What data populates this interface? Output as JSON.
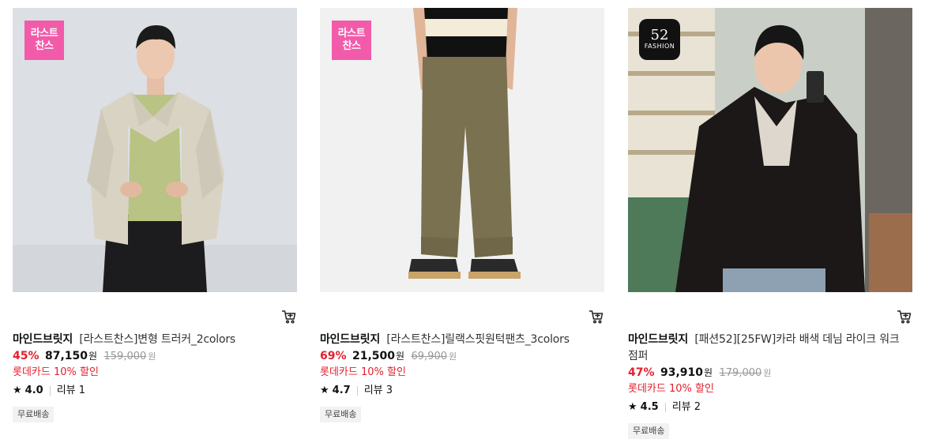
{
  "products": [
    {
      "badge_line1": "라스트",
      "badge_line2": "찬스",
      "brand": "마인드브릿지",
      "name": "[라스트찬스]변형 트러커_2colors",
      "discount_rate": "45%",
      "price": "87,150",
      "currency": "원",
      "original_price": "159,000",
      "card_discount": "롯데카드 10% 할인",
      "rating": "4.0",
      "review_label": "리뷰 1",
      "shipping_tag": "무료배송",
      "image_icon": "model-jacket-image"
    },
    {
      "badge_line1": "라스트",
      "badge_line2": "찬스",
      "brand": "마인드브릿지",
      "name": "[라스트찬스]릴랙스핏원턱팬츠_3colors",
      "discount_rate": "69%",
      "price": "21,500",
      "currency": "원",
      "original_price": "69,900",
      "card_discount": "롯데카드 10% 할인",
      "rating": "4.7",
      "review_label": "리뷰 3",
      "shipping_tag": "무료배송",
      "image_icon": "pants-image"
    },
    {
      "logo_top": "52",
      "logo_text": "FASHION",
      "brand": "마인드브릿지",
      "name": "[패션52][25FW]카라 배색 데님 라이크 워크 점퍼",
      "discount_rate": "47%",
      "price": "93,910",
      "currency": "원",
      "original_price": "179,000",
      "card_discount": "롯데카드 10% 할인",
      "rating": "4.5",
      "review_label": "리뷰 2",
      "shipping_tag": "무료배송",
      "image_icon": "model-mirror-selfie-image"
    }
  ],
  "colors": {
    "accent_red": "#e3202e",
    "badge_pink": "#f25ba9"
  }
}
